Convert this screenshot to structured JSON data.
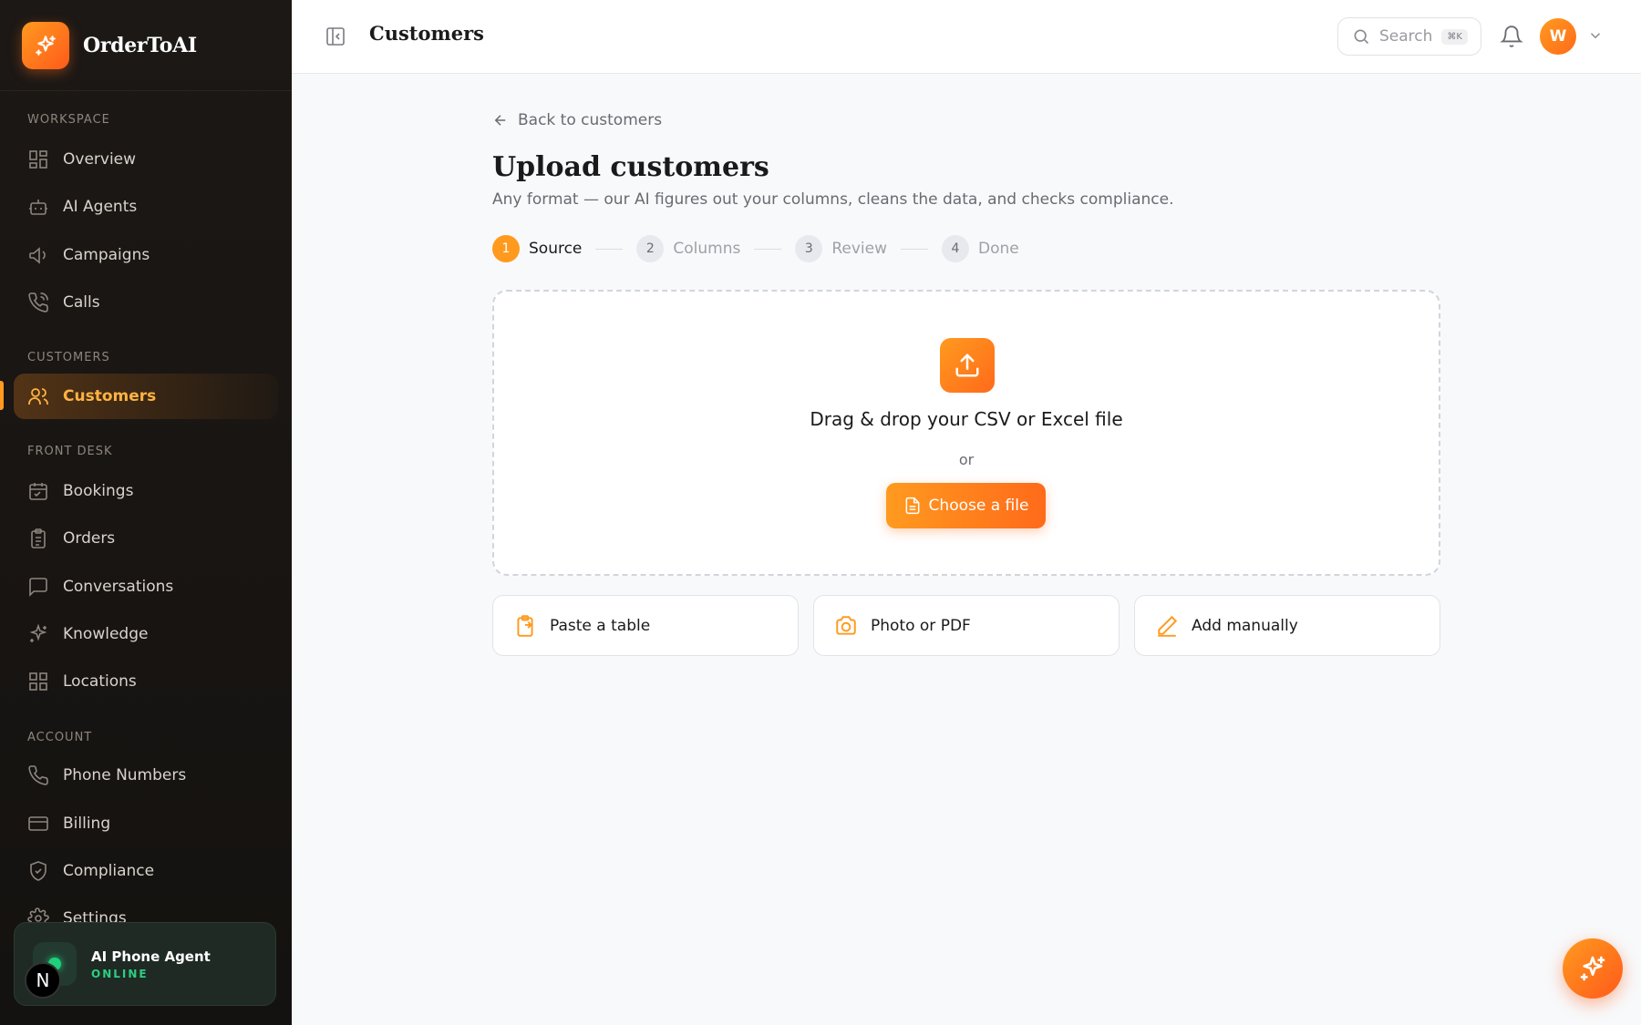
{
  "brand": {
    "name": "OrderToAI"
  },
  "sidebar": {
    "sections": {
      "workspace": "WORKSPACE",
      "customers": "CUSTOMERS",
      "front_desk": "FRONT DESK",
      "account": "ACCOUNT"
    },
    "items": [
      {
        "label": "Overview",
        "icon": "grid-icon"
      },
      {
        "label": "AI Agents",
        "icon": "bot-icon"
      },
      {
        "label": "Campaigns",
        "icon": "megaphone-icon"
      },
      {
        "label": "Calls",
        "icon": "phone-call-icon"
      },
      {
        "label": "Customers",
        "icon": "users-icon",
        "active": true
      },
      {
        "label": "Bookings",
        "icon": "calendar-icon"
      },
      {
        "label": "Orders",
        "icon": "clipboard-icon"
      },
      {
        "label": "Conversations",
        "icon": "message-icon"
      },
      {
        "label": "Knowledge",
        "icon": "sparkles-icon"
      },
      {
        "label": "Locations",
        "icon": "grid-icon"
      },
      {
        "label": "Phone Numbers",
        "icon": "phone-icon"
      },
      {
        "label": "Billing",
        "icon": "credit-card-icon"
      },
      {
        "label": "Compliance",
        "icon": "shield-icon"
      },
      {
        "label": "Settings",
        "icon": "gear-icon"
      }
    ],
    "agent_card": {
      "name": "AI Phone Agent",
      "status": "ONLINE"
    },
    "badge_letter": "N"
  },
  "header": {
    "title": "Customers",
    "search_placeholder": "Search",
    "search_shortcut": "⌘K",
    "avatar_initial": "W"
  },
  "main": {
    "back_link": "Back to customers",
    "title": "Upload customers",
    "subtitle": "Any format — our AI figures out your columns, cleans the data, and checks compliance.",
    "steps": [
      {
        "num": "1",
        "label": "Source",
        "active": true
      },
      {
        "num": "2",
        "label": "Columns",
        "active": false
      },
      {
        "num": "3",
        "label": "Review",
        "active": false
      },
      {
        "num": "4",
        "label": "Done",
        "active": false
      }
    ],
    "dropzone": {
      "title": "Drag & drop your CSV or Excel file",
      "or": "or",
      "button": "Choose a file"
    },
    "options": [
      {
        "label": "Paste a table",
        "icon": "clipboard-paste-icon"
      },
      {
        "label": "Photo or PDF",
        "icon": "camera-icon"
      },
      {
        "label": "Add manually",
        "icon": "pencil-icon"
      }
    ]
  },
  "colors": {
    "accent": "#ff9a1f",
    "accent_dark": "#ff6a1a",
    "sidebar_bg": "#1c1815",
    "online": "#2bd07f"
  }
}
